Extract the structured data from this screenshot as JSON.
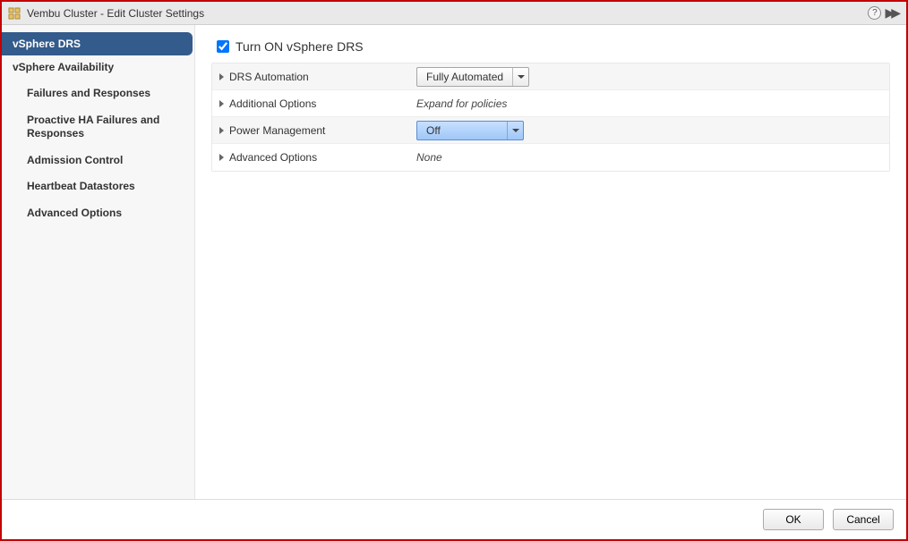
{
  "window": {
    "title": "Vembu Cluster - Edit Cluster Settings"
  },
  "sidebar": {
    "items": [
      {
        "label": "vSphere DRS",
        "selected": true
      },
      {
        "label": "vSphere Availability",
        "selected": false
      }
    ],
    "subitems": [
      {
        "label": "Failures and Responses"
      },
      {
        "label": "Proactive HA Failures and Responses"
      },
      {
        "label": "Admission Control"
      },
      {
        "label": "Heartbeat Datastores"
      },
      {
        "label": "Advanced Options"
      }
    ]
  },
  "main": {
    "turn_on_label": "Turn ON vSphere DRS",
    "turn_on_checked": true,
    "rows": {
      "drs_automation": {
        "label": "DRS Automation",
        "value": "Fully Automated"
      },
      "additional_options": {
        "label": "Additional Options",
        "value": "Expand for policies"
      },
      "power_management": {
        "label": "Power Management",
        "value": "Off"
      },
      "advanced_options": {
        "label": "Advanced Options",
        "value": "None"
      }
    }
  },
  "footer": {
    "ok": "OK",
    "cancel": "Cancel"
  }
}
